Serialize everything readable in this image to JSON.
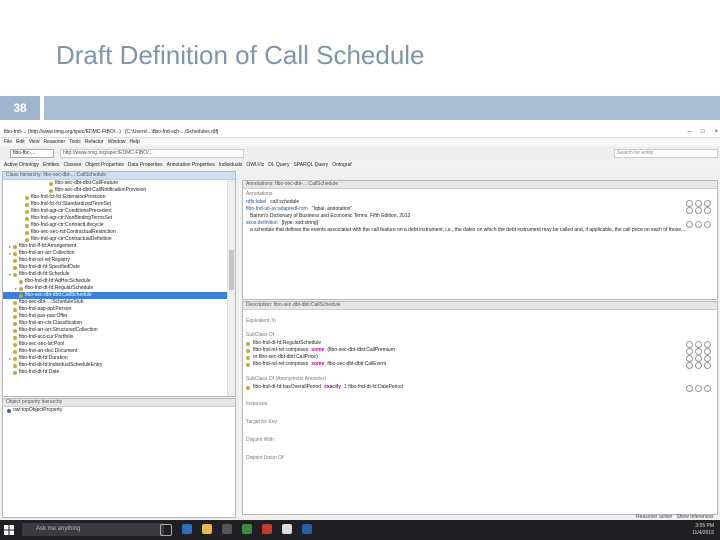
{
  "slide": {
    "title": "Draft Definition of Call Schedule",
    "number": "38"
  },
  "window": {
    "title": "fibo-fnd-... (http://www.omg.org/spec/EDMC-FIBO/...) : [C:\\Users\\...\\fibo-fnd-sch-...\\Schedules.rdf]",
    "controls": [
      "–",
      "□",
      "×"
    ]
  },
  "menubar": [
    "File",
    "Edit",
    "View",
    "Reasoner",
    "Tools",
    "Refactor",
    "Window",
    "Help"
  ],
  "toolbar": {
    "active_ontology": "fibo-fbc-...",
    "url": "http://www.omg.org/spec/EDMC-FIBO/...",
    "search_placeholder": "Search for entity"
  },
  "tabs": [
    "Active Ontology",
    "Entities",
    "Classes",
    "Object Properties",
    "Data Properties",
    "Annotation Properties",
    "Individuals",
    "OWLViz",
    "DL Query",
    "SPARQL Query",
    "Ontograf"
  ],
  "class_hierarchy": {
    "header": "Class hierarchy: fibo-sec-dbt-...:CallSchedule",
    "items": [
      {
        "label": "fibo-sec-dbt-dbti:CallFeature",
        "indent": 7,
        "expander": ""
      },
      {
        "label": "fibo-sec-dbt-dbti:CallNotificationProvision",
        "indent": 7,
        "expander": ""
      },
      {
        "label": "fibo-fnd-fct-fct:ExtensionProvision",
        "indent": 3,
        "expander": ""
      },
      {
        "label": "fibo-fnd-fct-fct:StandardizedTermSet",
        "indent": 3,
        "expander": ""
      },
      {
        "label": "fibo-fnd-agr-ctr:ConditionsPrecedent",
        "indent": 3,
        "expander": ""
      },
      {
        "label": "fibo-fnd-agr-ctr:NonBindingTermsSet",
        "indent": 3,
        "expander": ""
      },
      {
        "label": "fibo-fnd-agr-ctr:ContractLifecycle",
        "indent": 3,
        "expander": ""
      },
      {
        "label": "fibo-sec-sec-rst:ContractualRestriction",
        "indent": 3,
        "expander": ""
      },
      {
        "label": "fibo-fnd-agr-ctr:ContractualDefinition",
        "indent": 3,
        "expander": ""
      },
      {
        "label": "fibo-fnd-ff-fd:Arrangement",
        "indent": 1,
        "expander": "▸"
      },
      {
        "label": "fibo-fnd-arr-arr:Collection",
        "indent": 1,
        "expander": "▸"
      },
      {
        "label": "fibo-fnd-rel-rel:Registry",
        "indent": 1,
        "expander": ""
      },
      {
        "label": "fibo-fnd-dt-fd:SpecifiedDate",
        "indent": 1,
        "expander": ""
      },
      {
        "label": "fibo-fnd-dt-fd:Schedule",
        "indent": 1,
        "expander": "▾"
      },
      {
        "label": "fibo-fnd-dt-fd:AdHocSchedule",
        "indent": 2,
        "expander": ""
      },
      {
        "label": "fibo-fnd-dt-fd:RegularSchedule",
        "indent": 2,
        "expander": "▸"
      },
      {
        "label": "fibo-sec-dbt-dbti:CallSchedule",
        "indent": 2,
        "expander": "",
        "selected": true
      },
      {
        "label": "fibo-sec-dbt-...:ScheduleStub",
        "indent": 1,
        "expander": ""
      },
      {
        "label": "fibo-fnd-aap-ppl:Person",
        "indent": 1,
        "expander": ""
      },
      {
        "label": "fibo-fnd-pas-pas:Offer",
        "indent": 1,
        "expander": ""
      },
      {
        "label": "fibo-fnd-arr-cls:Classification",
        "indent": 1,
        "expander": ""
      },
      {
        "label": "fibo-fnd-arr-arr:StructuredCollection",
        "indent": 1,
        "expander": ""
      },
      {
        "label": "fibo-fnd-acc-cur:Portfolio",
        "indent": 1,
        "expander": ""
      },
      {
        "label": "fibo-sec-sec-lst:Pool",
        "indent": 1,
        "expander": ""
      },
      {
        "label": "fibo-fnd-arr-doc:Document",
        "indent": 1,
        "expander": ""
      },
      {
        "label": "fibo-fnd-dt-fd:Duration",
        "indent": 1,
        "expander": "▸"
      },
      {
        "label": "fibo-fnd-dt-fd:IndividualScheduleEntry",
        "indent": 1,
        "expander": ""
      },
      {
        "label": "fibo-fnd-dt-fd:Date",
        "indent": 1,
        "expander": ""
      }
    ]
  },
  "object_property_panel": {
    "header": "Object property hierarchy",
    "items": [
      "owl:topObjectProperty"
    ]
  },
  "annotations": {
    "header": "Annotations: fibo-sec-dbt-...:CallSchedule",
    "section": "Annotations",
    "rows": [
      {
        "prop": "rdfs:label",
        "value": "call schedule"
      },
      {
        "prop": "fibo-fnd-utl-av:adaptedFrom",
        "value": "\"Iqbal, annotation\""
      },
      {
        "prop": "",
        "value": "Barron's Dictionary of Business and Economic Terms, Fifth Edition, 2012"
      },
      {
        "prop": "skos:definition",
        "value": "[type: xsd:string]"
      },
      {
        "prop": "",
        "value": "a schedule that defines the events associated with the call feature on a debt instrument, i.e., the dates on which the debt instrument may be called and, if applicable, the call price on each of those..."
      }
    ]
  },
  "description": {
    "header": "Description: fibo-sec-dbt-dbti:CallSchedule",
    "equivalent_to": "Equivalent To",
    "subclass_of": "SubClass Of",
    "subclass_rows": [
      {
        "text": "fibo-fnd-dt-fd:RegularSchedule",
        "kw": ""
      },
      {
        "pre": "fibo-fnd-rel-rel:comprises",
        "kw": "some",
        "post": "(fibo-sec-dbt-dbti:CallPremium"
      },
      {
        "text": "or fibo-sec-dbt-dbti:CallPrice)",
        "kw": ""
      },
      {
        "pre": "fibo-fnd-rel-rel:comprises",
        "kw": "some",
        "post": "fibo-sec-dbt-dbti:CallEvent"
      }
    ],
    "general_class_axioms": "SubClass Of (Anonymous Ancestor)",
    "anon_rows": [
      {
        "pre": "fibo-fnd-dt-fd:hasOverallPeriod",
        "kw": "exactly",
        "post": "1 fibo-fnd-dt-fd:DatePeriod"
      }
    ],
    "sections": [
      "Instances",
      "Target for Key",
      "Disjoint With",
      "Disjoint Union Of"
    ]
  },
  "status_bar": {
    "reasoner": "Reasoner active",
    "inferences": "Show Inferences"
  },
  "taskbar": {
    "search": "Ask me anything",
    "time": "3:55 PM",
    "date": "11/4/2015"
  },
  "colors": {
    "selection": "#3d7fd6",
    "class_dot": "#c9a83a",
    "keyword": "#c000a0",
    "taskbar": "#1f1f24",
    "slide_accent": "#a9bdd3"
  }
}
